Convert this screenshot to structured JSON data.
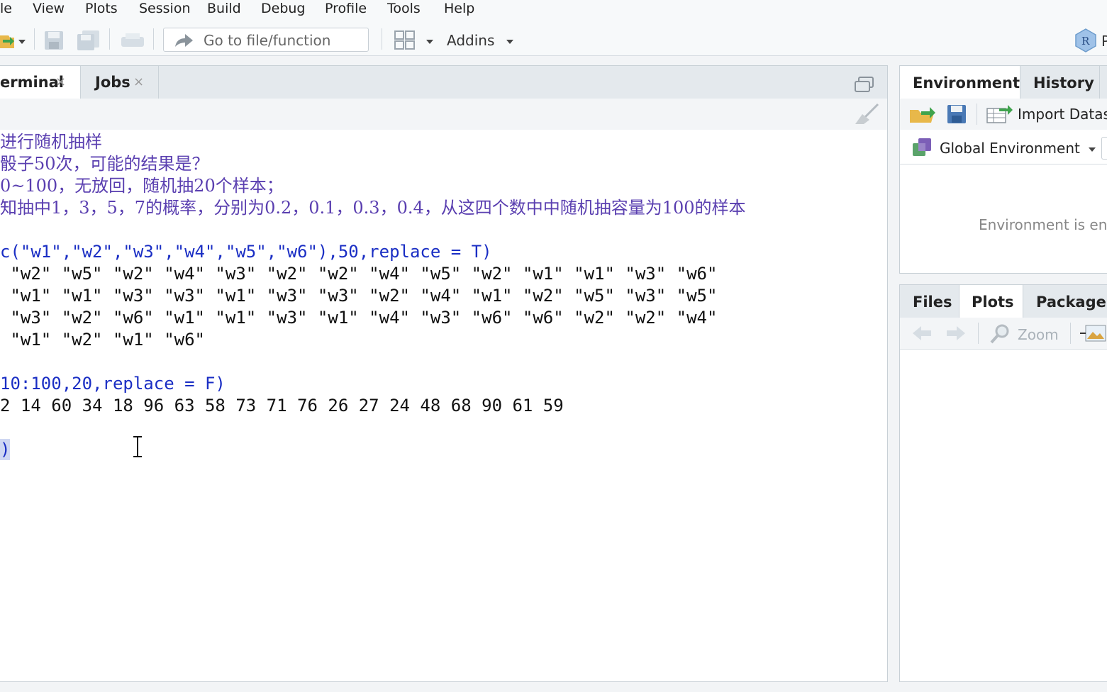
{
  "menu": {
    "items": [
      "le",
      "View",
      "Plots",
      "Session",
      "Build",
      "Debug",
      "Profile",
      "Tools",
      "Help"
    ]
  },
  "toolbar": {
    "goto_placeholder": "Go to file/function",
    "addins_label": "Addins",
    "project_initial": "R"
  },
  "console": {
    "tabs": [
      {
        "label": "erminal",
        "close": "×"
      },
      {
        "label": "Jobs",
        "close": "×"
      }
    ],
    "lines": [
      {
        "kind": "comment",
        "text": "进行随机抽样"
      },
      {
        "kind": "comment",
        "text": "骰子50次，可能的结果是？"
      },
      {
        "kind": "comment",
        "text": "0~100，无放回，随机抽20个样本；"
      },
      {
        "kind": "comment",
        "text": "知抽中1，3，5，7的概率，分别为0.2，0.1，0.3，0.4，从这四个数中中随机抽容量为100的样本"
      },
      {
        "kind": "blank",
        "text": ""
      },
      {
        "kind": "cmd",
        "text": "c(\"w1\",\"w2\",\"w3\",\"w4\",\"w5\",\"w6\"),50,replace = T)"
      },
      {
        "kind": "out",
        "text": " \"w2\" \"w5\" \"w2\" \"w4\" \"w3\" \"w2\" \"w2\" \"w4\" \"w5\" \"w2\" \"w1\" \"w1\" \"w3\" \"w6\""
      },
      {
        "kind": "out",
        "text": " \"w1\" \"w1\" \"w3\" \"w3\" \"w1\" \"w3\" \"w3\" \"w2\" \"w4\" \"w1\" \"w2\" \"w5\" \"w3\" \"w5\""
      },
      {
        "kind": "out",
        "text": " \"w3\" \"w2\" \"w6\" \"w1\" \"w1\" \"w3\" \"w1\" \"w4\" \"w3\" \"w6\" \"w6\" \"w2\" \"w2\" \"w4\""
      },
      {
        "kind": "out",
        "text": " \"w1\" \"w2\" \"w1\" \"w6\""
      },
      {
        "kind": "blank",
        "text": ""
      },
      {
        "kind": "cmd",
        "text": "10:100,20,replace = F)"
      },
      {
        "kind": "out",
        "text": "2 14 60 34 18 96 63 58 73 71 76 26 27 24 48 68 90 61 59"
      },
      {
        "kind": "blank",
        "text": ""
      },
      {
        "kind": "cmd",
        "text": ")"
      }
    ]
  },
  "environment": {
    "tabs": [
      "Environment",
      "History"
    ],
    "import_label": "Import Datas",
    "scope_label": "Global Environment",
    "empty_text": "Environment is en"
  },
  "files": {
    "tabs": [
      "Files",
      "Plots",
      "Packages"
    ],
    "zoom_label": "Zoom"
  },
  "colors": {
    "comment": "#5a3fb0",
    "command": "#1a2ec4",
    "output": "#111111"
  }
}
